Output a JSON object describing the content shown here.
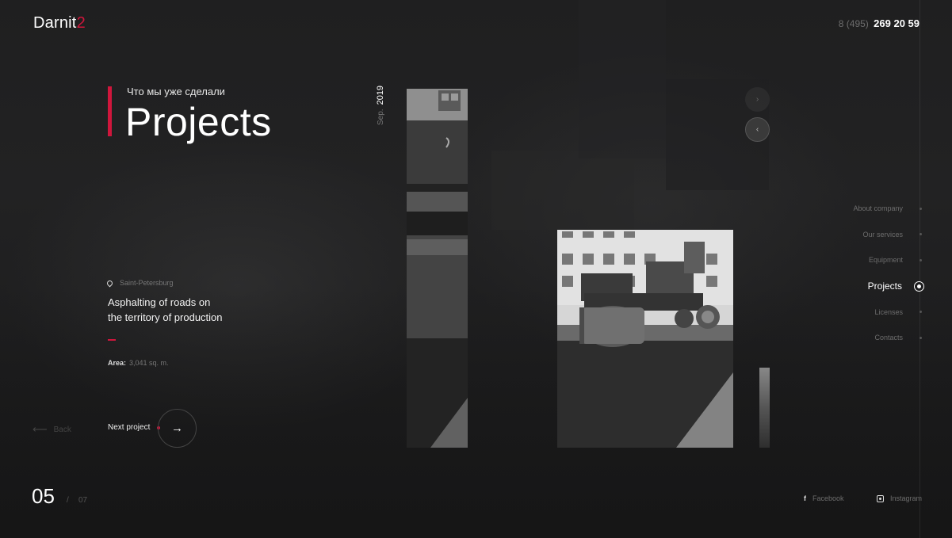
{
  "brand": {
    "name": "Darnit",
    "number": "2",
    "accent_color": "#d0163c"
  },
  "contact": {
    "phone_prefix": "8 (495)",
    "phone_number": "269 20 59"
  },
  "section": {
    "subtitle": "Что мы уже сделали",
    "title": "Projects"
  },
  "project": {
    "date_month": "Sep.",
    "date_year": "2019",
    "location": "Saint-Petersburg",
    "name_line1": "Asphalting of roads on",
    "name_line2": "the territory of production",
    "area_label": "Area:",
    "area_value": "3,041 sq. m."
  },
  "controls": {
    "back_label": "Back",
    "next_label": "Next project",
    "arrow_right": "→",
    "arrow_left": "⟵",
    "chevron_right": "›",
    "chevron_left": "‹"
  },
  "counter": {
    "current": "05",
    "separator": "/",
    "total": "07"
  },
  "nav": {
    "items": [
      {
        "label": "About company",
        "active": false
      },
      {
        "label": "Our services",
        "active": false
      },
      {
        "label": "Equipment",
        "active": false
      },
      {
        "label": "Projects",
        "active": true
      },
      {
        "label": "Licenses",
        "active": false
      },
      {
        "label": "Contacts",
        "active": false
      }
    ]
  },
  "social": {
    "facebook_label": "Facebook",
    "facebook_icon": "f",
    "instagram_label": "Instagram"
  }
}
